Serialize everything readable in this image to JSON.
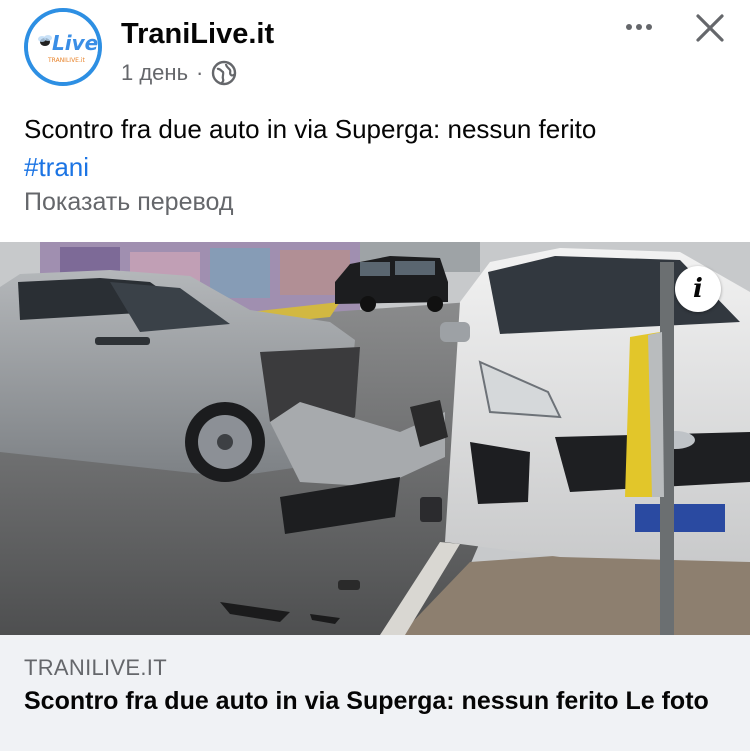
{
  "post": {
    "page_name": "TraniLive.it",
    "time": "1 день",
    "separator": "·",
    "privacy_icon": "globe-icon",
    "text": "Scontro fra due auto in via Superga: nessun ferito",
    "hashtag": "#trani",
    "translate_label": "Показать перевод",
    "more_icon": "more-dots-icon",
    "close_icon": "close-icon"
  },
  "avatar": {
    "logo_text": "Live",
    "logo_subtext": "TRANILIVE.it"
  },
  "photo": {
    "info_label": "i"
  },
  "link_card": {
    "domain": "TRANILIVE.IT",
    "title": "Scontro fra due auto in via Superga: nessun ferito Le foto"
  },
  "colors": {
    "accent": "#1b74e4",
    "secondary_text": "#65676b",
    "card_bg": "#f0f2f5",
    "avatar_ring": "#2d8fe3"
  }
}
